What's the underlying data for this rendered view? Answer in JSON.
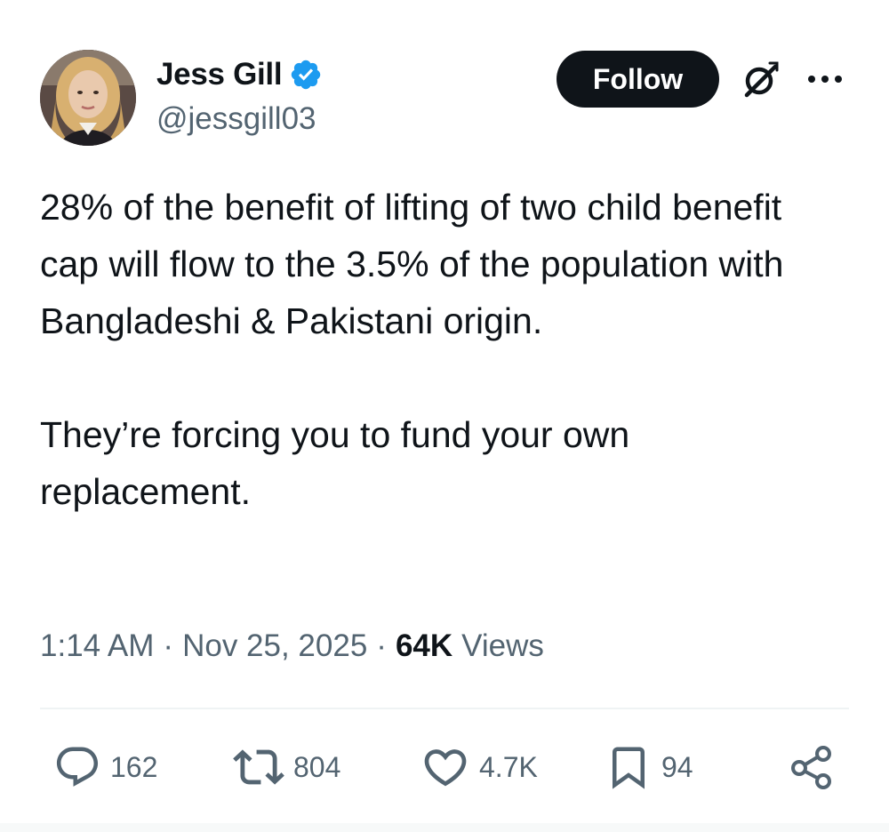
{
  "author": {
    "display_name": "Jess Gill",
    "handle": "@jessgill03",
    "verified_icon": "verified-badge-icon",
    "verified_color": "#1d9bf0"
  },
  "header": {
    "follow_label": "Follow",
    "grok_icon": "grok-icon",
    "more_icon": "more-options-icon"
  },
  "tweet": {
    "text": "28% of the benefit of lifting of two child benefit cap will flow to the 3.5% of the population with Bangladeshi & Pakistani origin.\n\nThey’re forcing you to fund your own replacement."
  },
  "meta": {
    "time": "1:14 AM",
    "separator": "·",
    "date": "Nov 25, 2025",
    "views_count": "64K",
    "views_label": "Views"
  },
  "actions": {
    "replies": {
      "icon": "reply-icon",
      "count": "162"
    },
    "reposts": {
      "icon": "repost-icon",
      "count": "804"
    },
    "likes": {
      "icon": "heart-icon",
      "count": "4.7K"
    },
    "bookmarks": {
      "icon": "bookmark-icon",
      "count": "94"
    },
    "share": {
      "icon": "share-icon"
    }
  },
  "colors": {
    "text_primary": "#0f1419",
    "text_secondary": "#536471",
    "follow_bg": "#0f1419",
    "divider": "#eff3f4"
  }
}
